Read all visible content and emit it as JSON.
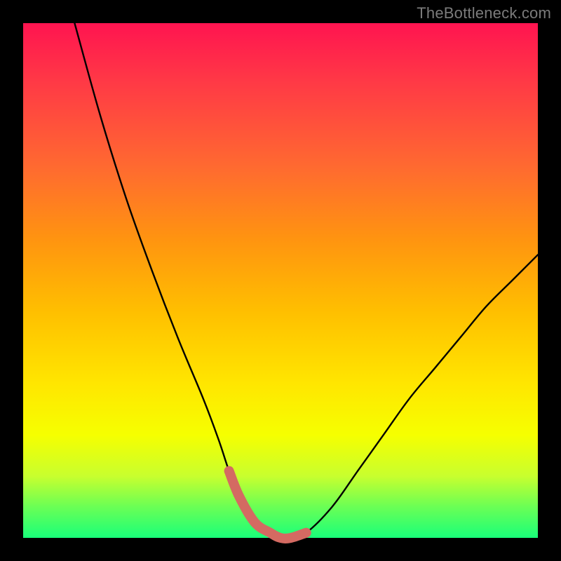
{
  "watermark": "TheBottleneck.com",
  "chart_data": {
    "type": "line",
    "title": "",
    "xlabel": "",
    "ylabel": "",
    "xlim": [
      0,
      100
    ],
    "ylim": [
      0,
      100
    ],
    "series": [
      {
        "name": "bottleneck-curve",
        "x": [
          10,
          15,
          20,
          25,
          30,
          35,
          38,
          40,
          42,
          45,
          48,
          50,
          52,
          55,
          60,
          65,
          70,
          75,
          80,
          85,
          90,
          95,
          100
        ],
        "y": [
          100,
          82,
          66,
          52,
          39,
          27,
          19,
          13,
          8,
          3,
          1,
          0,
          0,
          1,
          6,
          13,
          20,
          27,
          33,
          39,
          45,
          50,
          55
        ]
      }
    ],
    "highlight": {
      "name": "recommended-range",
      "x": [
        40,
        42,
        45,
        48,
        50,
        52,
        55
      ],
      "y": [
        13,
        8,
        3,
        1,
        0,
        0,
        1
      ]
    },
    "colors": {
      "curve": "#000000",
      "highlight": "#d46a62",
      "gradient_top": "#ff1450",
      "gradient_bottom": "#19ff7a"
    }
  }
}
